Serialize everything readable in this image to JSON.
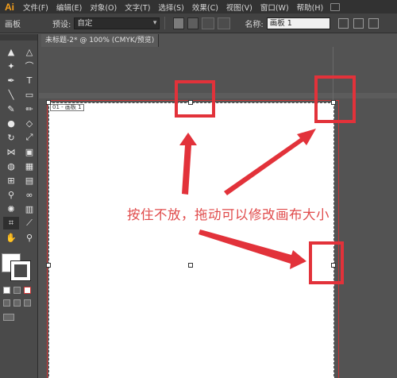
{
  "app": {
    "logo": "Ai"
  },
  "menu": [
    "文件(F)",
    "编辑(E)",
    "对象(O)",
    "文字(T)",
    "选择(S)",
    "效果(C)",
    "视图(V)",
    "窗口(W)",
    "帮助(H)"
  ],
  "controlbar": {
    "tool_label": "画板",
    "preset_label": "预设:",
    "preset_value": "自定",
    "name_label": "名称:",
    "name_value": "画板 1"
  },
  "document": {
    "tab_title": "未标题-2* @ 100% (CMYK/预览)",
    "artboard_label": "01 - 画板 1"
  },
  "annotation": {
    "text": "按住不放，拖动可以修改画布大小",
    "color": "#e2323a"
  },
  "colors": {
    "accent": "#f7a01c",
    "ui_dark": "#323232",
    "panel": "#4a4a4a",
    "canvas_bg": "#535353",
    "artboard": "#ffffff"
  },
  "tools": [
    {
      "icon": "selection-tool-icon",
      "glyph": "▲"
    },
    {
      "icon": "direct-selection-tool-icon",
      "glyph": "△"
    },
    {
      "icon": "magic-wand-tool-icon",
      "glyph": "✦"
    },
    {
      "icon": "lasso-tool-icon",
      "glyph": "⌒"
    },
    {
      "icon": "pen-tool-icon",
      "glyph": "✒"
    },
    {
      "icon": "type-tool-icon",
      "glyph": "T"
    },
    {
      "icon": "line-tool-icon",
      "glyph": "╲"
    },
    {
      "icon": "rectangle-tool-icon",
      "glyph": "▭"
    },
    {
      "icon": "paintbrush-tool-icon",
      "glyph": "✎"
    },
    {
      "icon": "pencil-tool-icon",
      "glyph": "✏"
    },
    {
      "icon": "blob-brush-tool-icon",
      "glyph": "●"
    },
    {
      "icon": "eraser-tool-icon",
      "glyph": "◇"
    },
    {
      "icon": "rotate-tool-icon",
      "glyph": "↻"
    },
    {
      "icon": "scale-tool-icon",
      "glyph": "⤢"
    },
    {
      "icon": "width-tool-icon",
      "glyph": "⋈"
    },
    {
      "icon": "free-transform-tool-icon",
      "glyph": "▣"
    },
    {
      "icon": "shape-builder-tool-icon",
      "glyph": "◍"
    },
    {
      "icon": "perspective-grid-tool-icon",
      "glyph": "▦"
    },
    {
      "icon": "mesh-tool-icon",
      "glyph": "⊞"
    },
    {
      "icon": "gradient-tool-icon",
      "glyph": "▤"
    },
    {
      "icon": "eyedropper-tool-icon",
      "glyph": "⚲"
    },
    {
      "icon": "blend-tool-icon",
      "glyph": "∞"
    },
    {
      "icon": "symbol-sprayer-tool-icon",
      "glyph": "✺"
    },
    {
      "icon": "column-graph-tool-icon",
      "glyph": "▥"
    },
    {
      "icon": "artboard-tool-icon",
      "glyph": "⌗"
    },
    {
      "icon": "slice-tool-icon",
      "glyph": "⟋"
    },
    {
      "icon": "hand-tool-icon",
      "glyph": "✋"
    },
    {
      "icon": "zoom-tool-icon",
      "glyph": "⚲"
    }
  ]
}
